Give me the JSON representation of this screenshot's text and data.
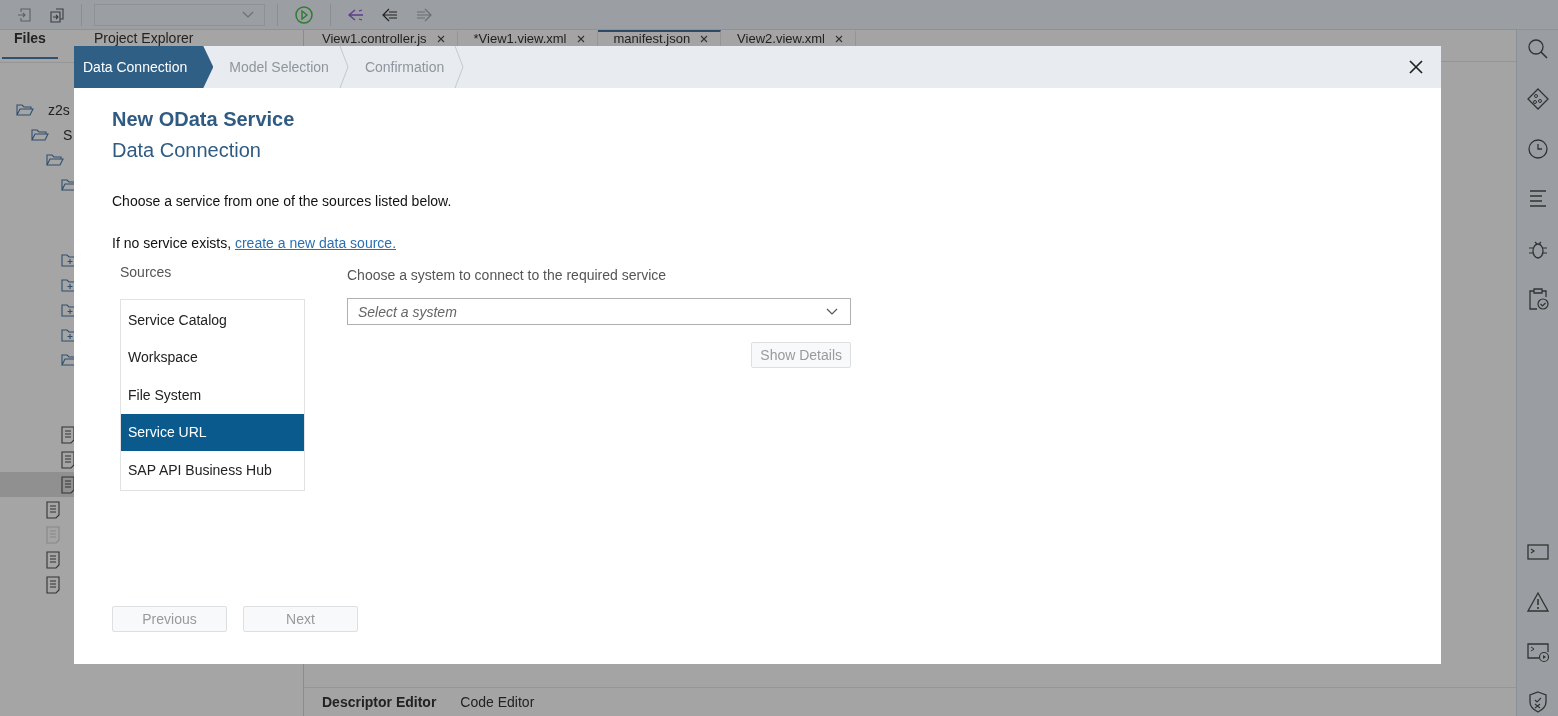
{
  "left_panel": {
    "tabs": [
      {
        "label": "Files",
        "selected": true
      },
      {
        "label": "Project Explorer",
        "selected": false
      }
    ],
    "tree": [
      {
        "kind": "folder",
        "label": "z2s",
        "expanded": true,
        "selected": false,
        "children": [
          {
            "kind": "folder",
            "label": "S",
            "expanded": true,
            "selected": false,
            "children": [
              {
                "kind": "folder",
                "expanded": true,
                "selected": false,
                "children": [
                  {
                    "kind": "folder",
                    "expanded": true,
                    "selected": false
                  },
                  {
                    "kind": "folder",
                    "expanded": false,
                    "selected": false
                  },
                  {
                    "kind": "folder",
                    "expanded": false,
                    "selected": false
                  },
                  {
                    "kind": "folder",
                    "expanded": false,
                    "selected": false
                  },
                  {
                    "kind": "folder",
                    "expanded": false,
                    "selected": false
                  },
                  {
                    "kind": "folder",
                    "expanded": true,
                    "selected": false
                  },
                  {
                    "kind": "file",
                    "dimmed": false,
                    "selected": false
                  },
                  {
                    "kind": "file",
                    "dimmed": false,
                    "selected": false
                  },
                  {
                    "kind": "file",
                    "dimmed": false,
                    "selected": true
                  }
                ]
              },
              {
                "kind": "file",
                "dimmed": false,
                "selected": false
              },
              {
                "kind": "file",
                "dimmed": true,
                "selected": false
              },
              {
                "kind": "file",
                "dimmed": false,
                "selected": false
              },
              {
                "kind": "file",
                "dimmed": false,
                "selected": false
              }
            ]
          }
        ]
      }
    ]
  },
  "editor_tabs": [
    {
      "label": "View1.controller.js",
      "selected": false
    },
    {
      "label": "*View1.view.xml",
      "selected": false
    },
    {
      "label": "manifest.json",
      "selected": true
    },
    {
      "label": "View2.view.xml",
      "selected": false
    }
  ],
  "editor_bottom_tabs": [
    {
      "label": "Descriptor Editor",
      "selected": true
    },
    {
      "label": "Code Editor",
      "selected": false
    }
  ],
  "dialog": {
    "steps": [
      {
        "label": "Data Connection",
        "selected": true
      },
      {
        "label": "Model Selection",
        "selected": false
      },
      {
        "label": "Confirmation",
        "selected": false
      }
    ],
    "title": "New OData Service",
    "subtitle": "Data Connection",
    "intro": "Choose a service from one of the sources listed below.",
    "prompt": "If no service exists,",
    "link": "create a new data source.",
    "sources_label": "Sources",
    "sources": [
      {
        "label": "Service Catalog",
        "selected": false
      },
      {
        "label": "Workspace",
        "selected": false
      },
      {
        "label": "File System",
        "selected": false
      },
      {
        "label": "Service URL",
        "selected": true
      },
      {
        "label": "SAP API Business Hub",
        "selected": false
      }
    ],
    "system_label": "Choose a system to connect to the required service",
    "system_select": {
      "placeholder": "Select a system"
    },
    "show_details": {
      "label": "Show Details",
      "disabled": true
    },
    "buttons": [
      {
        "label": "Previous",
        "disabled": true
      },
      {
        "label": "Next",
        "disabled": true
      }
    ]
  }
}
